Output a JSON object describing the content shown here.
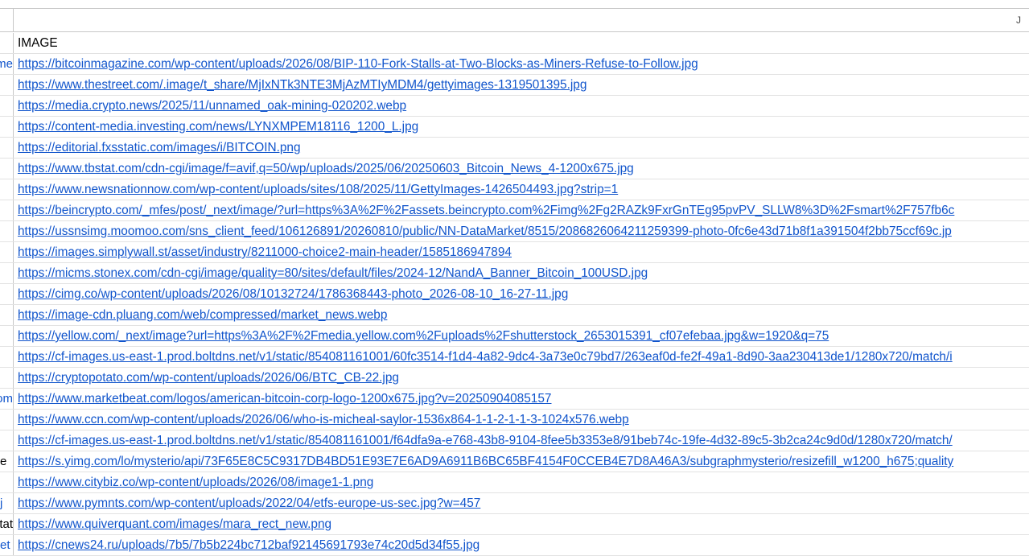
{
  "sheet": {
    "column_letter": "J",
    "header": "IMAGE",
    "rows": [
      {
        "left": "me",
        "left_color": "link",
        "url": "https://bitcoinmagazine.com/wp-content/uploads/2026/08/BIP-110-Fork-Stalls-at-Two-Blocks-as-Miners-Refuse-to-Follow.jpg"
      },
      {
        "left": "",
        "left_color": "link",
        "url": "https://www.thestreet.com/.image/t_share/MjIxNTk3NTE3MjAzMTIyMDM4/gettyimages-1319501395.jpg"
      },
      {
        "left": "",
        "left_color": "link",
        "url": "https://media.crypto.news/2025/11/unnamed_oak-mining-020202.webp"
      },
      {
        "left": "",
        "left_color": "link",
        "url": "https://content-media.investing.com/news/LYNXMPEM18116_1200_L.jpg"
      },
      {
        "left": "",
        "left_color": "link",
        "url": "https://editorial.fxsstatic.com/images/i/BITCOIN.png"
      },
      {
        "left": "",
        "left_color": "link",
        "url": "https://www.tbstat.com/cdn-cgi/image/f=avif,q=50/wp/uploads/2025/06/20250603_Bitcoin_News_4-1200x675.jpg"
      },
      {
        "left": "",
        "left_color": "link",
        "url": "https://www.newsnationnow.com/wp-content/uploads/sites/108/2025/11/GettyImages-1426504493.jpg?strip=1"
      },
      {
        "left": "",
        "left_color": "link",
        "url": "https://beincrypto.com/_mfes/post/_next/image/?url=https%3A%2F%2Fassets.beincrypto.com%2Fimg%2Fg2RAZk9FxrGnTEg95pvPV_SLLW8%3D%2Fsmart%2F757fb6c"
      },
      {
        "left": "",
        "left_color": "link",
        "url": "https://ussnsimg.moomoo.com/sns_client_feed/106126891/20260810/public/NN-DataMarket/8515/2086826064211259399-photo-0fc6e43d71b8f1a391504f2bb75ccf69c.jp"
      },
      {
        "left": "",
        "left_color": "link",
        "url": "https://images.simplywall.st/asset/industry/8211000-choice2-main-header/1585186947894"
      },
      {
        "left": "",
        "left_color": "link",
        "url": "https://micms.stonex.com/cdn-cgi/image/quality=80/sites/default/files/2024-12/NandA_Banner_Bitcoin_100USD.jpg"
      },
      {
        "left": "",
        "left_color": "link",
        "url": "https://cimg.co/wp-content/uploads/2026/08/10132724/1786368443-photo_2026-08-10_16-27-11.jpg"
      },
      {
        "left": "",
        "left_color": "link",
        "url": "https://image-cdn.pluang.com/web/compressed/market_news.webp"
      },
      {
        "left": "",
        "left_color": "link",
        "url": "https://yellow.com/_next/image?url=https%3A%2F%2Fmedia.yellow.com%2Fuploads%2Fshutterstock_2653015391_cf07efebaa.jpg&w=1920&q=75"
      },
      {
        "left": "",
        "left_color": "link",
        "url": "https://cf-images.us-east-1.prod.boltdns.net/v1/static/854081161001/60fc3514-f1d4-4a82-9dc4-3a73e0c79bd7/263eaf0d-fe2f-49a1-8d90-3aa230413de1/1280x720/match/i"
      },
      {
        "left": "",
        "left_color": "link",
        "url": "https://cryptopotato.com/wp-content/uploads/2026/06/BTC_CB-22.jpg"
      },
      {
        "left": "om",
        "left_color": "link",
        "url": "https://www.marketbeat.com/logos/american-bitcoin-corp-logo-1200x675.jpg?v=20250904085157"
      },
      {
        "left": "",
        "left_color": "link",
        "url": "https://www.ccn.com/wp-content/uploads/2026/06/who-is-micheal-saylor-1536x864-1-1-2-1-1-3-1024x576.webp"
      },
      {
        "left": "",
        "left_color": "link",
        "url": "https://cf-images.us-east-1.prod.boltdns.net/v1/static/854081161001/f64dfa9a-e768-43b8-9104-8fee5b3353e8/91beb74c-19fe-4d32-89c5-3b2ca24c9d0d/1280x720/match/"
      },
      {
        "left": "e",
        "left_color": "black",
        "url": "https://s.yimg.com/lo/mysterio/api/73F65E8C5C9317DB4BD51E93E7E6AD9A6911B6BC65BF4154F0CCEB4E7D8A46A3/subgraphmysterio/resizefill_w1200_h675;quality"
      },
      {
        "left": "",
        "left_color": "link",
        "url": "https://www.citybiz.co/wp-content/uploads/2026/08/image1-1.png"
      },
      {
        "left": "j",
        "left_color": "link",
        "url": "https://www.pymnts.com/wp-content/uploads/2022/04/etfs-europe-us-sec.jpg?w=457"
      },
      {
        "left": "tat",
        "left_color": "black",
        "url": "https://www.quiverquant.com/images/mara_rect_new.png"
      },
      {
        "left": "et",
        "left_color": "link",
        "url": "https://cnews24.ru/uploads/7b5/7b5b224bc712baf92145691793e74c20d5d34f55.jpg"
      }
    ]
  }
}
